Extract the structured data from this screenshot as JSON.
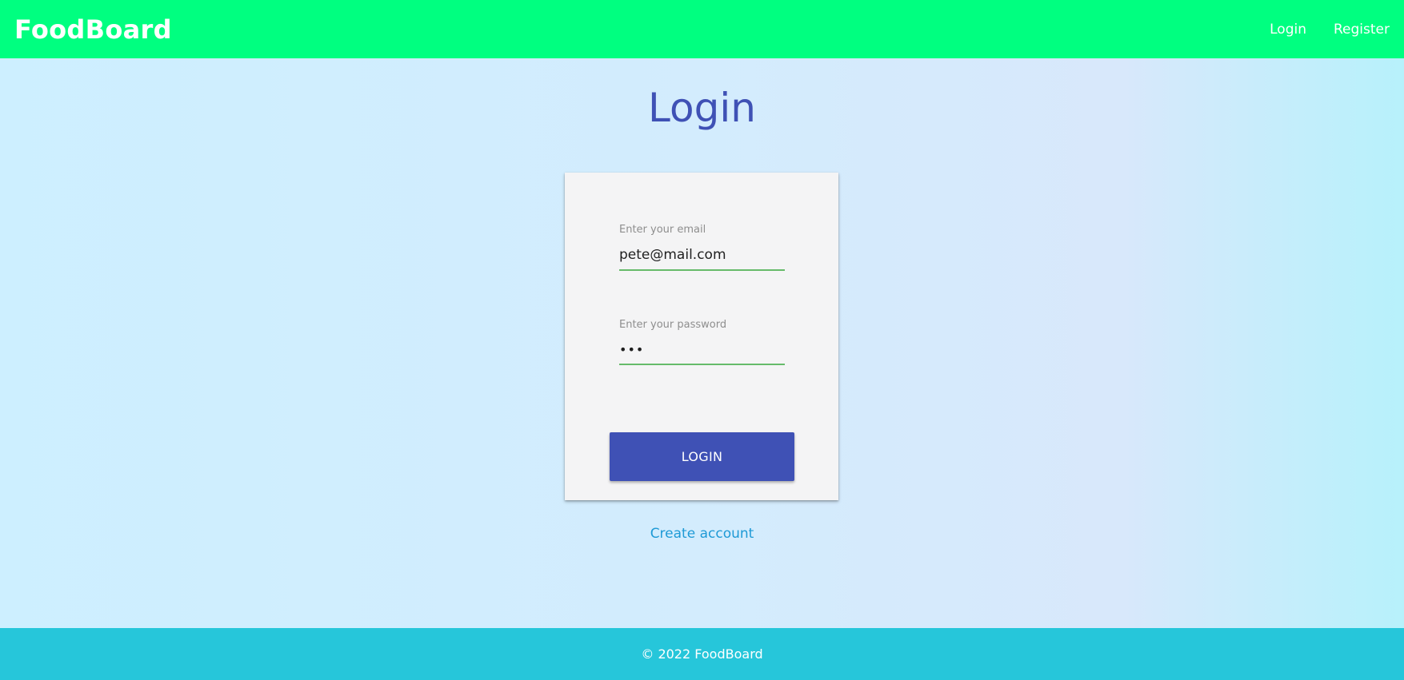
{
  "colors": {
    "navbar_bg": "#00ff80",
    "footer_bg": "#26c6da",
    "title_color": "#3f51b5",
    "button_bg": "#3f51b5",
    "link_color": "#1e9ad6",
    "input_underline": "#66bb6a"
  },
  "navbar": {
    "brand": "FoodBoard",
    "links": [
      {
        "label": "Login"
      },
      {
        "label": "Register"
      }
    ]
  },
  "page": {
    "title": "Login"
  },
  "form": {
    "email": {
      "label": "Enter your email",
      "value": "pete@mail.com"
    },
    "password": {
      "label": "Enter your password",
      "value": "•••"
    },
    "submit_label": "LOGIN"
  },
  "create_account": {
    "label": "Create account"
  },
  "footer": {
    "text": "© 2022 FoodBoard"
  }
}
